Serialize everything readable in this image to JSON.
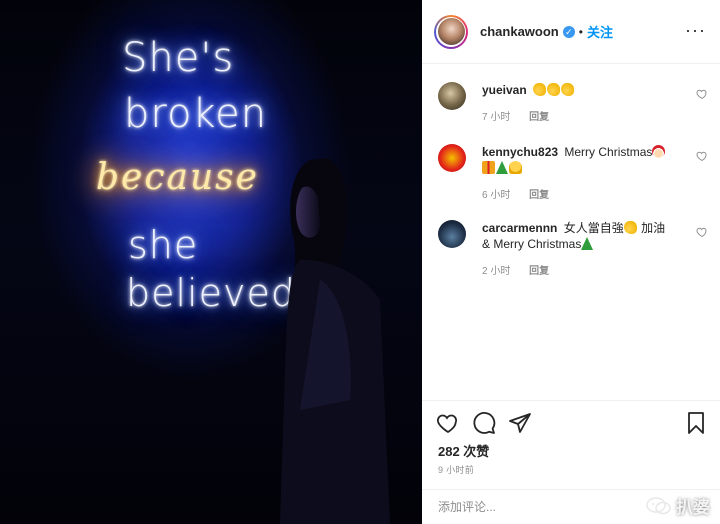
{
  "photo": {
    "neon_lines": [
      "She's",
      "broken",
      "because",
      "she",
      "believed"
    ]
  },
  "header": {
    "username": "chankawoon",
    "separator": "•",
    "follow_label": "关注",
    "more_label": "···"
  },
  "comments": [
    {
      "user": "yueivan",
      "text": "",
      "emojis": [
        "flexed-biceps",
        "flexed-biceps",
        "flexed-biceps"
      ],
      "time": "7 小时",
      "reply_label": "回复"
    },
    {
      "user": "kennychu823",
      "text": "Merry Christmas",
      "emojis": [
        "santa",
        "gift",
        "christmas-tree",
        "bell"
      ],
      "time": "6 小时",
      "reply_label": "回复"
    },
    {
      "user": "carcarmennn",
      "text_before": "女人當自強",
      "text_mid": " 加油",
      "text_line2": "& Merry Christmas",
      "emojis": [
        "flexed-biceps",
        "christmas-tree"
      ],
      "time": "2 小时",
      "reply_label": "回复"
    }
  ],
  "footer": {
    "likes": "282 次赞",
    "timestamp": "9 小时前",
    "add_comment_placeholder": "添加评论..."
  },
  "watermark": {
    "text": "扒婆"
  },
  "colors": {
    "link_blue": "#0095f6",
    "verified_blue": "#3897f0",
    "meta_gray": "#8e8e8e",
    "text_dark": "#262626",
    "neon_blue": "#3355ff",
    "neon_orange": "#ff9000"
  }
}
